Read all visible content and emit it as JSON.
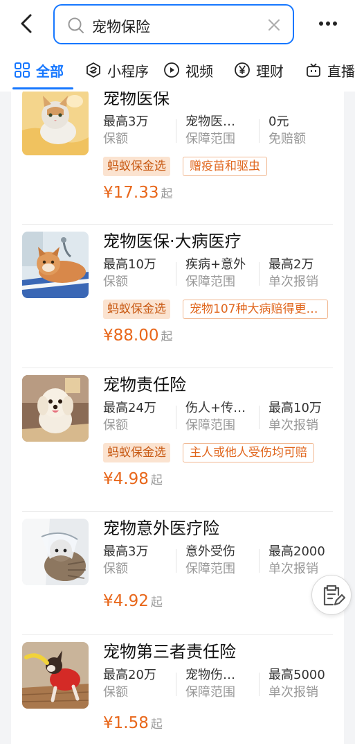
{
  "search": {
    "query": "宠物保险"
  },
  "tabs": [
    {
      "label": "全部",
      "icon": "grid-icon",
      "active": true
    },
    {
      "label": "小程序",
      "icon": "mini-program-icon"
    },
    {
      "label": "视频",
      "icon": "play-icon"
    },
    {
      "label": "理财",
      "icon": "yen-icon"
    },
    {
      "label": "直播",
      "icon": "tv-icon"
    }
  ],
  "colors": {
    "accent": "#1677ff",
    "price": "#e8671b",
    "badge_bg": "#fbe3d0",
    "badge_text": "#c85a14"
  },
  "products": [
    {
      "title": "宠物医保",
      "stats": [
        {
          "value": "最高3万",
          "label": "保额"
        },
        {
          "value": "宠物医…",
          "label": "保障范围"
        },
        {
          "value": "0元",
          "label": "免赔额"
        }
      ],
      "badge": "蚂蚁保金选",
      "tag": "赠疫苗和驱虫",
      "price": "¥17.33",
      "price_suffix": "起",
      "image": "cat-on-blanket"
    },
    {
      "title": "宠物医保·大病医疗",
      "stats": [
        {
          "value": "最高10万",
          "label": "保额"
        },
        {
          "value": "疾病+意外",
          "label": "保障范围"
        },
        {
          "value": "最高2万",
          "label": "单次报销"
        }
      ],
      "badge": "蚂蚁保金选",
      "tag": "宠物107种大病赔得更…",
      "price": "¥88.00",
      "price_suffix": "起",
      "image": "cat-at-vet"
    },
    {
      "title": "宠物责任险",
      "stats": [
        {
          "value": "最高24万",
          "label": "保额"
        },
        {
          "value": "伤人+传…",
          "label": "保障范围"
        },
        {
          "value": "最高10万",
          "label": "单次报销"
        }
      ],
      "badge": "蚂蚁保金选",
      "tag": "主人或他人受伤均可赔",
      "price": "¥4.98",
      "price_suffix": "起",
      "image": "white-dog"
    },
    {
      "title": "宠物意外医疗险",
      "stats": [
        {
          "value": "最高3万",
          "label": "保额"
        },
        {
          "value": "意外受伤",
          "label": "保障范围"
        },
        {
          "value": "最高2000",
          "label": "单次报销"
        }
      ],
      "price": "¥4.92",
      "price_suffix": "起",
      "image": "cat-with-cone"
    },
    {
      "title": "宠物第三者责任险",
      "stats": [
        {
          "value": "最高20万",
          "label": "保额"
        },
        {
          "value": "宠物伤…",
          "label": "保障范围"
        },
        {
          "value": "最高5000",
          "label": "单次报销"
        }
      ],
      "price": "¥1.58",
      "price_suffix": "起",
      "image": "dog-playing-toy"
    }
  ]
}
